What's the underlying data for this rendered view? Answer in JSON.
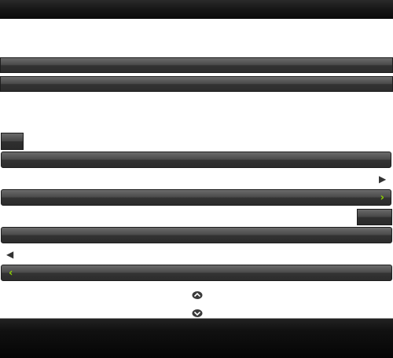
{
  "icons": {
    "bar_forward": "chevron-right-icon",
    "bar_back": "chevron-left-icon",
    "standalone_next": "arrow-next-icon",
    "standalone_prev": "arrow-prev-icon",
    "up": "chevron-up-icon",
    "down": "chevron-down-icon"
  },
  "colors": {
    "accent": "#8fd400",
    "bar": "#4a4a4a",
    "header": "#141414"
  }
}
